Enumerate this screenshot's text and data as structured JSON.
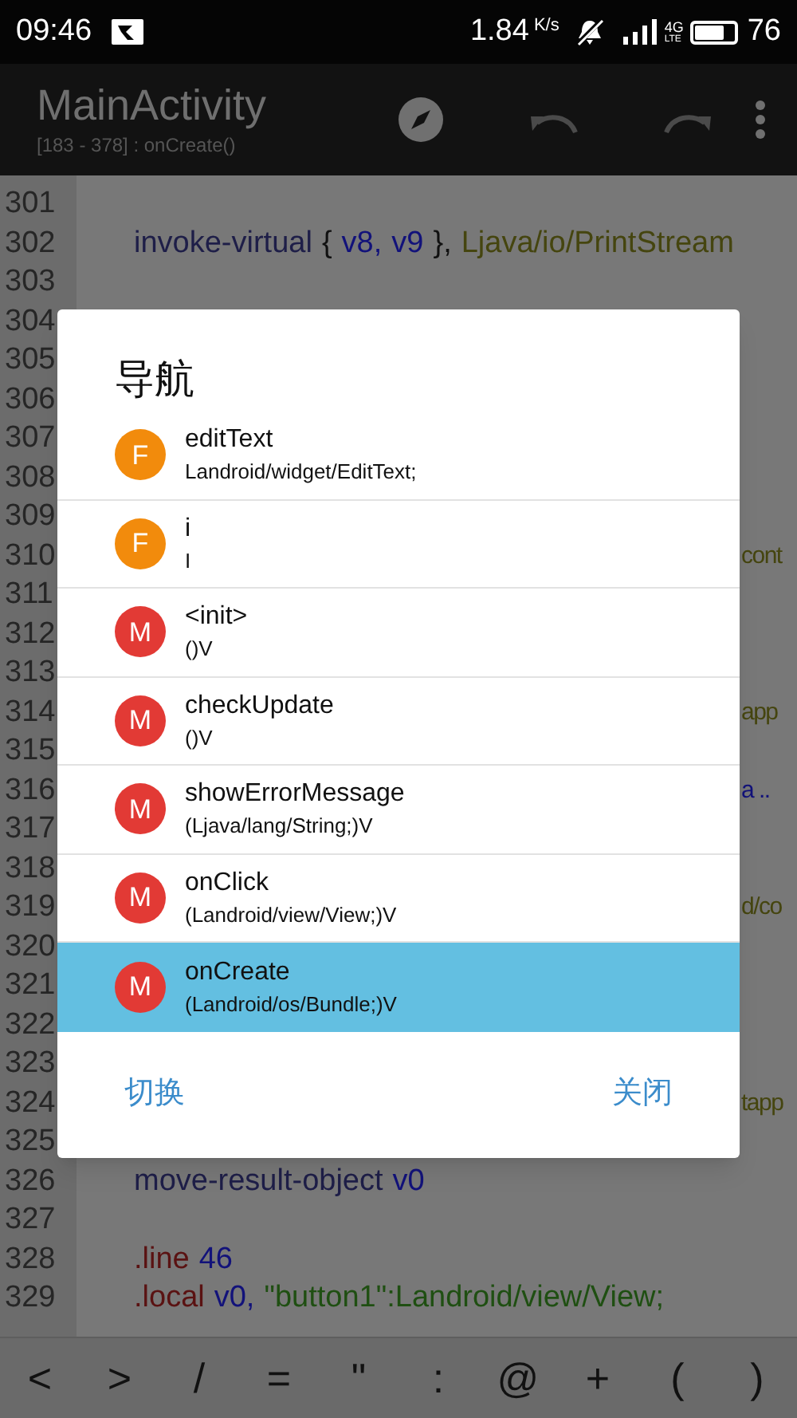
{
  "status_bar": {
    "time": "09:46",
    "speed": "1.84",
    "speed_unit": "K/s",
    "network": "4G",
    "network_sub": "LTE",
    "battery_text": "76"
  },
  "toolbar": {
    "title": "MainActivity",
    "subtitle": "[183 - 378] : onCreate()"
  },
  "editor": {
    "lines": [
      {
        "number": "301"
      },
      {
        "number": "302",
        "kind": "code",
        "tokens": [
          {
            "text": "invoke-virtual",
            "kind": "op"
          },
          {
            "text": "{",
            "kind": "plain"
          },
          {
            "text": "v8,",
            "kind": "reg"
          },
          {
            "text": "v9",
            "kind": "reg"
          },
          {
            "text": "},",
            "kind": "plain"
          },
          {
            "text": "Ljava/io/PrintStream",
            "kind": "type"
          }
        ]
      },
      {
        "number": "303"
      },
      {
        "number": "304"
      },
      {
        "number": "305"
      },
      {
        "number": "306"
      },
      {
        "number": "307"
      },
      {
        "number": "308"
      },
      {
        "number": "309"
      },
      {
        "number": "310",
        "kind": "fragment",
        "tokens": [
          {
            "text": "cont",
            "kind": "type"
          }
        ]
      },
      {
        "number": "311"
      },
      {
        "number": "312"
      },
      {
        "number": "313"
      },
      {
        "number": "314",
        "kind": "fragment",
        "tokens": [
          {
            "text": "app",
            "kind": "type"
          }
        ]
      },
      {
        "number": "315"
      },
      {
        "number": "316",
        "kind": "fragment",
        "tokens": [
          {
            "text": "a ..",
            "kind": "reg"
          }
        ]
      },
      {
        "number": "317"
      },
      {
        "number": "318"
      },
      {
        "number": "319",
        "kind": "fragment",
        "tokens": [
          {
            "text": "d/co",
            "kind": "type"
          }
        ]
      },
      {
        "number": "320"
      },
      {
        "number": "321"
      },
      {
        "number": "322"
      },
      {
        "number": "323"
      },
      {
        "number": "324",
        "kind": "fragment",
        "tokens": [
          {
            "text": "tapp",
            "kind": "type"
          }
        ]
      },
      {
        "number": "325"
      },
      {
        "number": "326",
        "kind": "code",
        "tokens": [
          {
            "text": "move-result-object",
            "kind": "op"
          },
          {
            "text": "v0",
            "kind": "reg"
          }
        ]
      },
      {
        "number": "327"
      },
      {
        "number": "328",
        "kind": "code",
        "tokens": [
          {
            "text": ".line",
            "kind": "directive"
          },
          {
            "text": "46",
            "kind": "reg"
          }
        ]
      },
      {
        "number": "329",
        "kind": "code",
        "tokens": [
          {
            "text": ".local",
            "kind": "directive"
          },
          {
            "text": "v0,",
            "kind": "reg"
          },
          {
            "text": "\"button1\":Landroid/view/View;",
            "kind": "string"
          }
        ]
      }
    ]
  },
  "dialog": {
    "title": "导航",
    "items": [
      {
        "kind": "field",
        "badge": "F",
        "name": "editText",
        "signature": "Landroid/widget/EditText;",
        "selected": false
      },
      {
        "kind": "field",
        "badge": "F",
        "name": "i",
        "signature": "I",
        "selected": false
      },
      {
        "kind": "method",
        "badge": "M",
        "name": "<init>",
        "signature": "()V",
        "selected": false
      },
      {
        "kind": "method",
        "badge": "M",
        "name": "checkUpdate",
        "signature": "()V",
        "selected": false
      },
      {
        "kind": "method",
        "badge": "M",
        "name": "showErrorMessage",
        "signature": "(Ljava/lang/String;)V",
        "selected": false
      },
      {
        "kind": "method",
        "badge": "M",
        "name": "onClick",
        "signature": "(Landroid/view/View;)V",
        "selected": false
      },
      {
        "kind": "method",
        "badge": "M",
        "name": "onCreate",
        "signature": "(Landroid/os/Bundle;)V",
        "selected": true
      }
    ],
    "buttons": [
      "切换",
      "关闭"
    ]
  },
  "symbol_bar": [
    "<",
    ">",
    "/",
    "=",
    "\"",
    ":",
    "@",
    "+",
    "(",
    ")"
  ]
}
